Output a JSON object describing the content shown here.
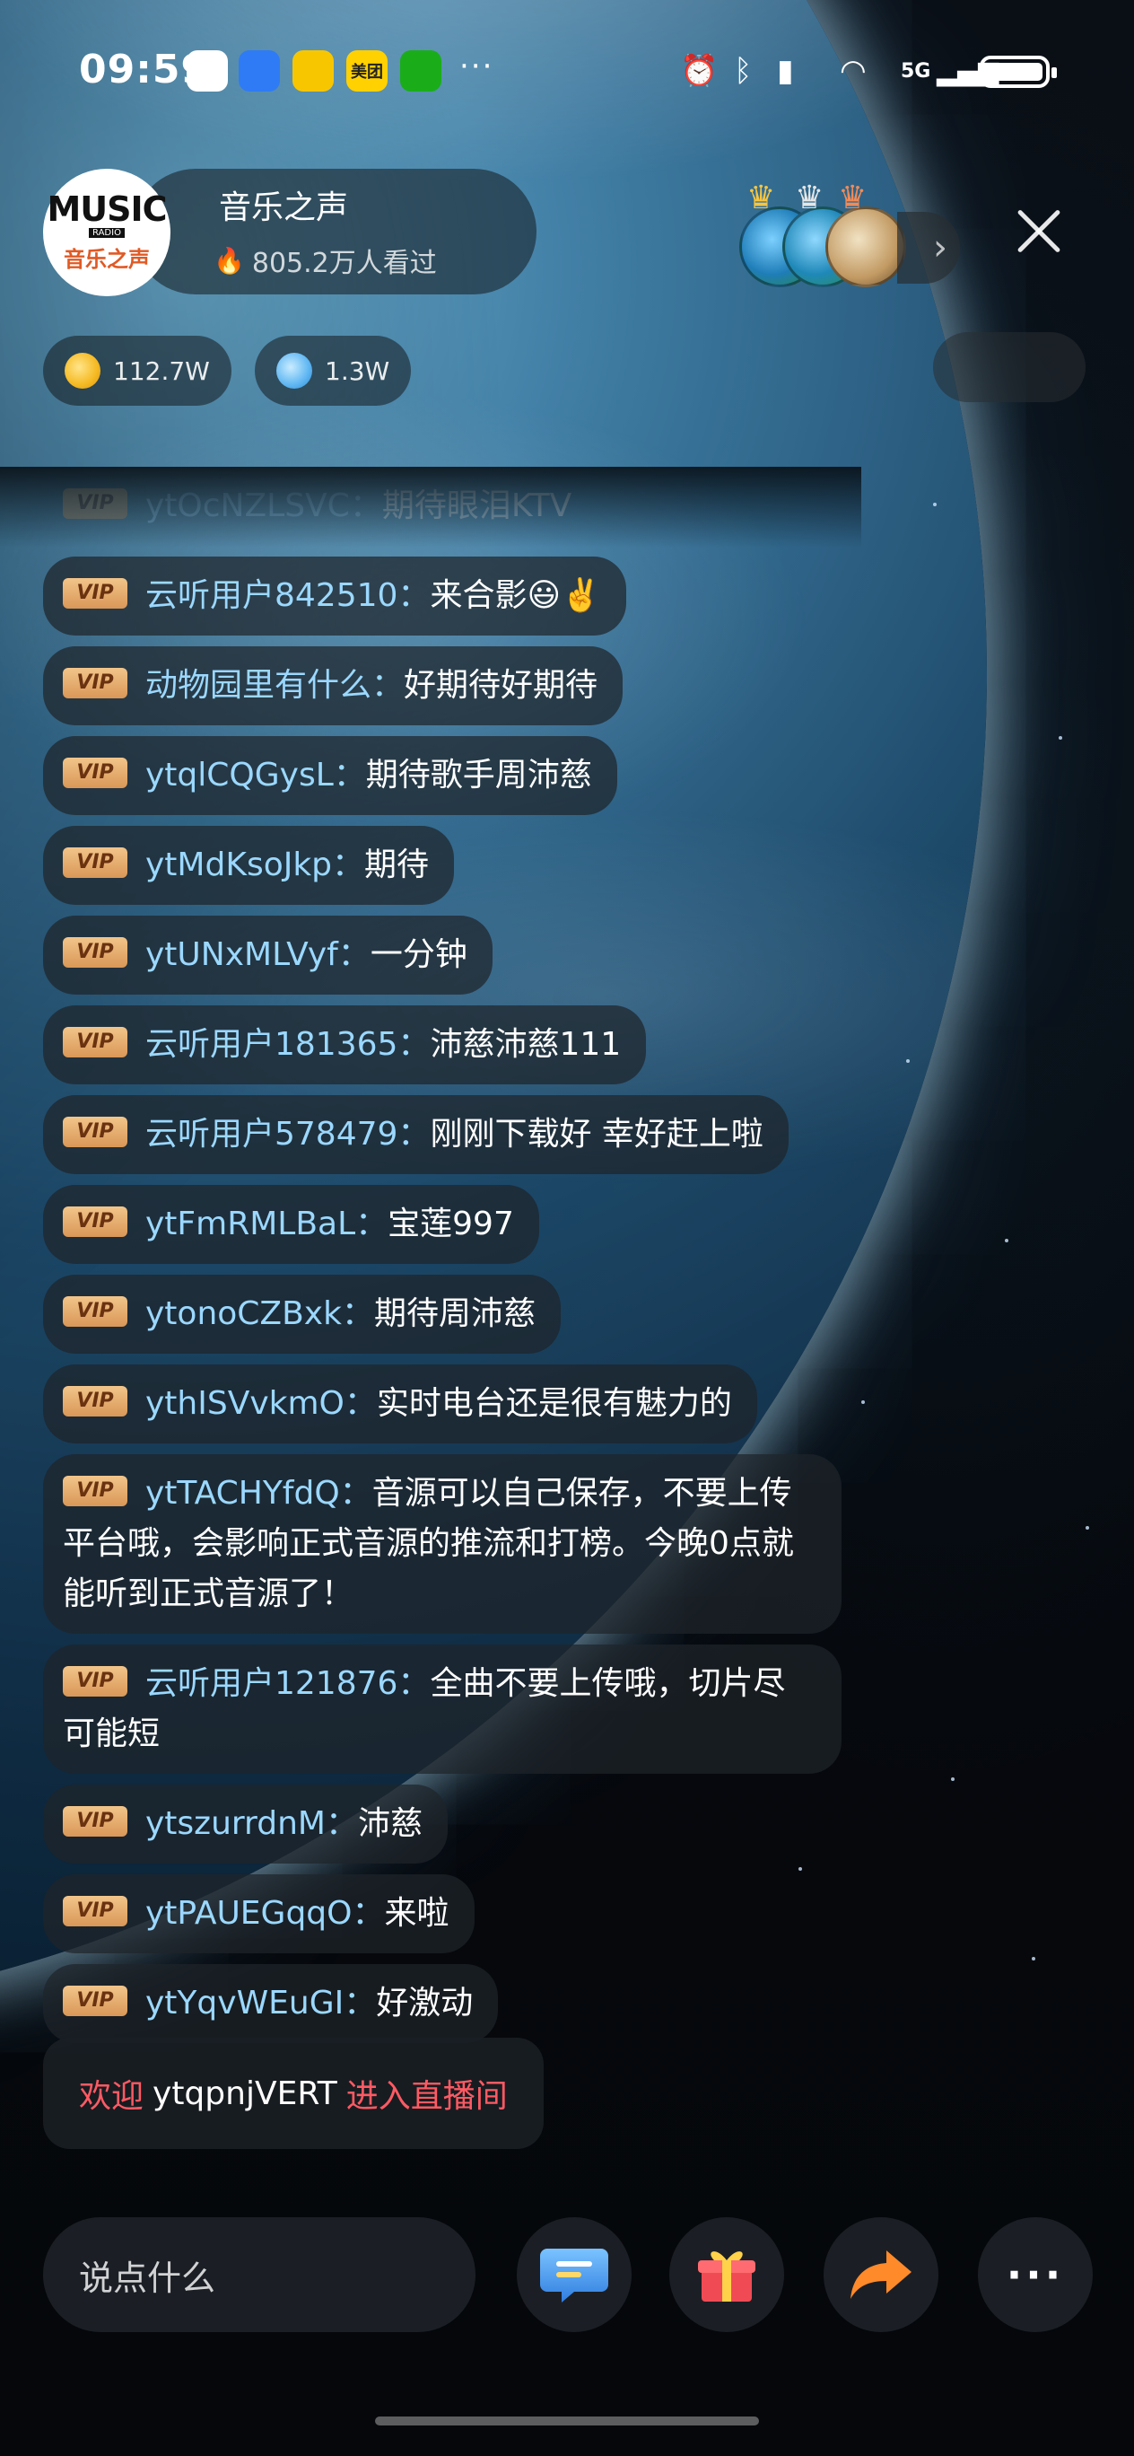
{
  "status_bar": {
    "time": "09:59",
    "apps": [
      {
        "name": "lantern-app-icon",
        "label": "",
        "color": "#ffffff"
      },
      {
        "name": "blue-app-icon",
        "label": "",
        "color": "#2f7bf5"
      },
      {
        "name": "weibo-icon",
        "label": "",
        "color": "#f7c600"
      },
      {
        "name": "meituan-icon",
        "label": "美团",
        "color": "#ffd100"
      },
      {
        "name": "wechat-icon",
        "label": "",
        "color": "#1aad19"
      }
    ],
    "more": "···",
    "network": "5G"
  },
  "host": {
    "avatar_text": "MUSIC",
    "avatar_radio": "RADIO",
    "avatar_cn": "音乐之声",
    "name": "音乐之声",
    "views": "805.2万人看过"
  },
  "stats": {
    "coins": "112.7W",
    "diamonds": "1.3W"
  },
  "chat": [
    {
      "user": "ytOcNZLSVC：",
      "text": "期待眼泪KTV",
      "faded": true
    },
    {
      "user": "云听用户842510：",
      "text": "来合影😃✌️"
    },
    {
      "user": "动物园里有什么：",
      "text": "好期待好期待"
    },
    {
      "user": "ytqlCQGysL：",
      "text": "期待歌手周沛慈"
    },
    {
      "user": "ytMdKsoJkp：",
      "text": "期待"
    },
    {
      "user": "ytUNxMLVyf：",
      "text": "一分钟"
    },
    {
      "user": "云听用户181365：",
      "text": "沛慈沛慈111"
    },
    {
      "user": "云听用户578479：",
      "text": "刚刚下载好 幸好赶上啦"
    },
    {
      "user": "ytFmRMLBaL：",
      "text": "宝莲997"
    },
    {
      "user": "ytonoCZBxk：",
      "text": "期待周沛慈"
    },
    {
      "user": "ythISVvkmO：",
      "text": "实时电台还是很有魅力的"
    },
    {
      "user": "ytTACHYfdQ：",
      "text": "音源可以自己保存，不要上传平台哦，会影响正式音源的推流和打榜。今晚0点就能听到正式音源了！"
    },
    {
      "user": "云听用户121876：",
      "text": "全曲不要上传哦，切片尽可能短"
    },
    {
      "user": "ytszurrdnM：",
      "text": "沛慈"
    },
    {
      "user": "ytPAUEGqqO：",
      "text": "来啦"
    },
    {
      "user": "ytYqvWEuGI：",
      "text": "好激动"
    }
  ],
  "vip_label": "VIP",
  "welcome": {
    "prefix": "欢迎",
    "name": "ytqpnjVERT",
    "suffix": "进入直播间"
  },
  "bottom_bar": {
    "input_placeholder": "说点什么",
    "more_label": "···"
  },
  "colors": {
    "username": "#9bd8ff",
    "welcome_accent": "#ff5a63",
    "vip_gold": "#e0a765"
  }
}
